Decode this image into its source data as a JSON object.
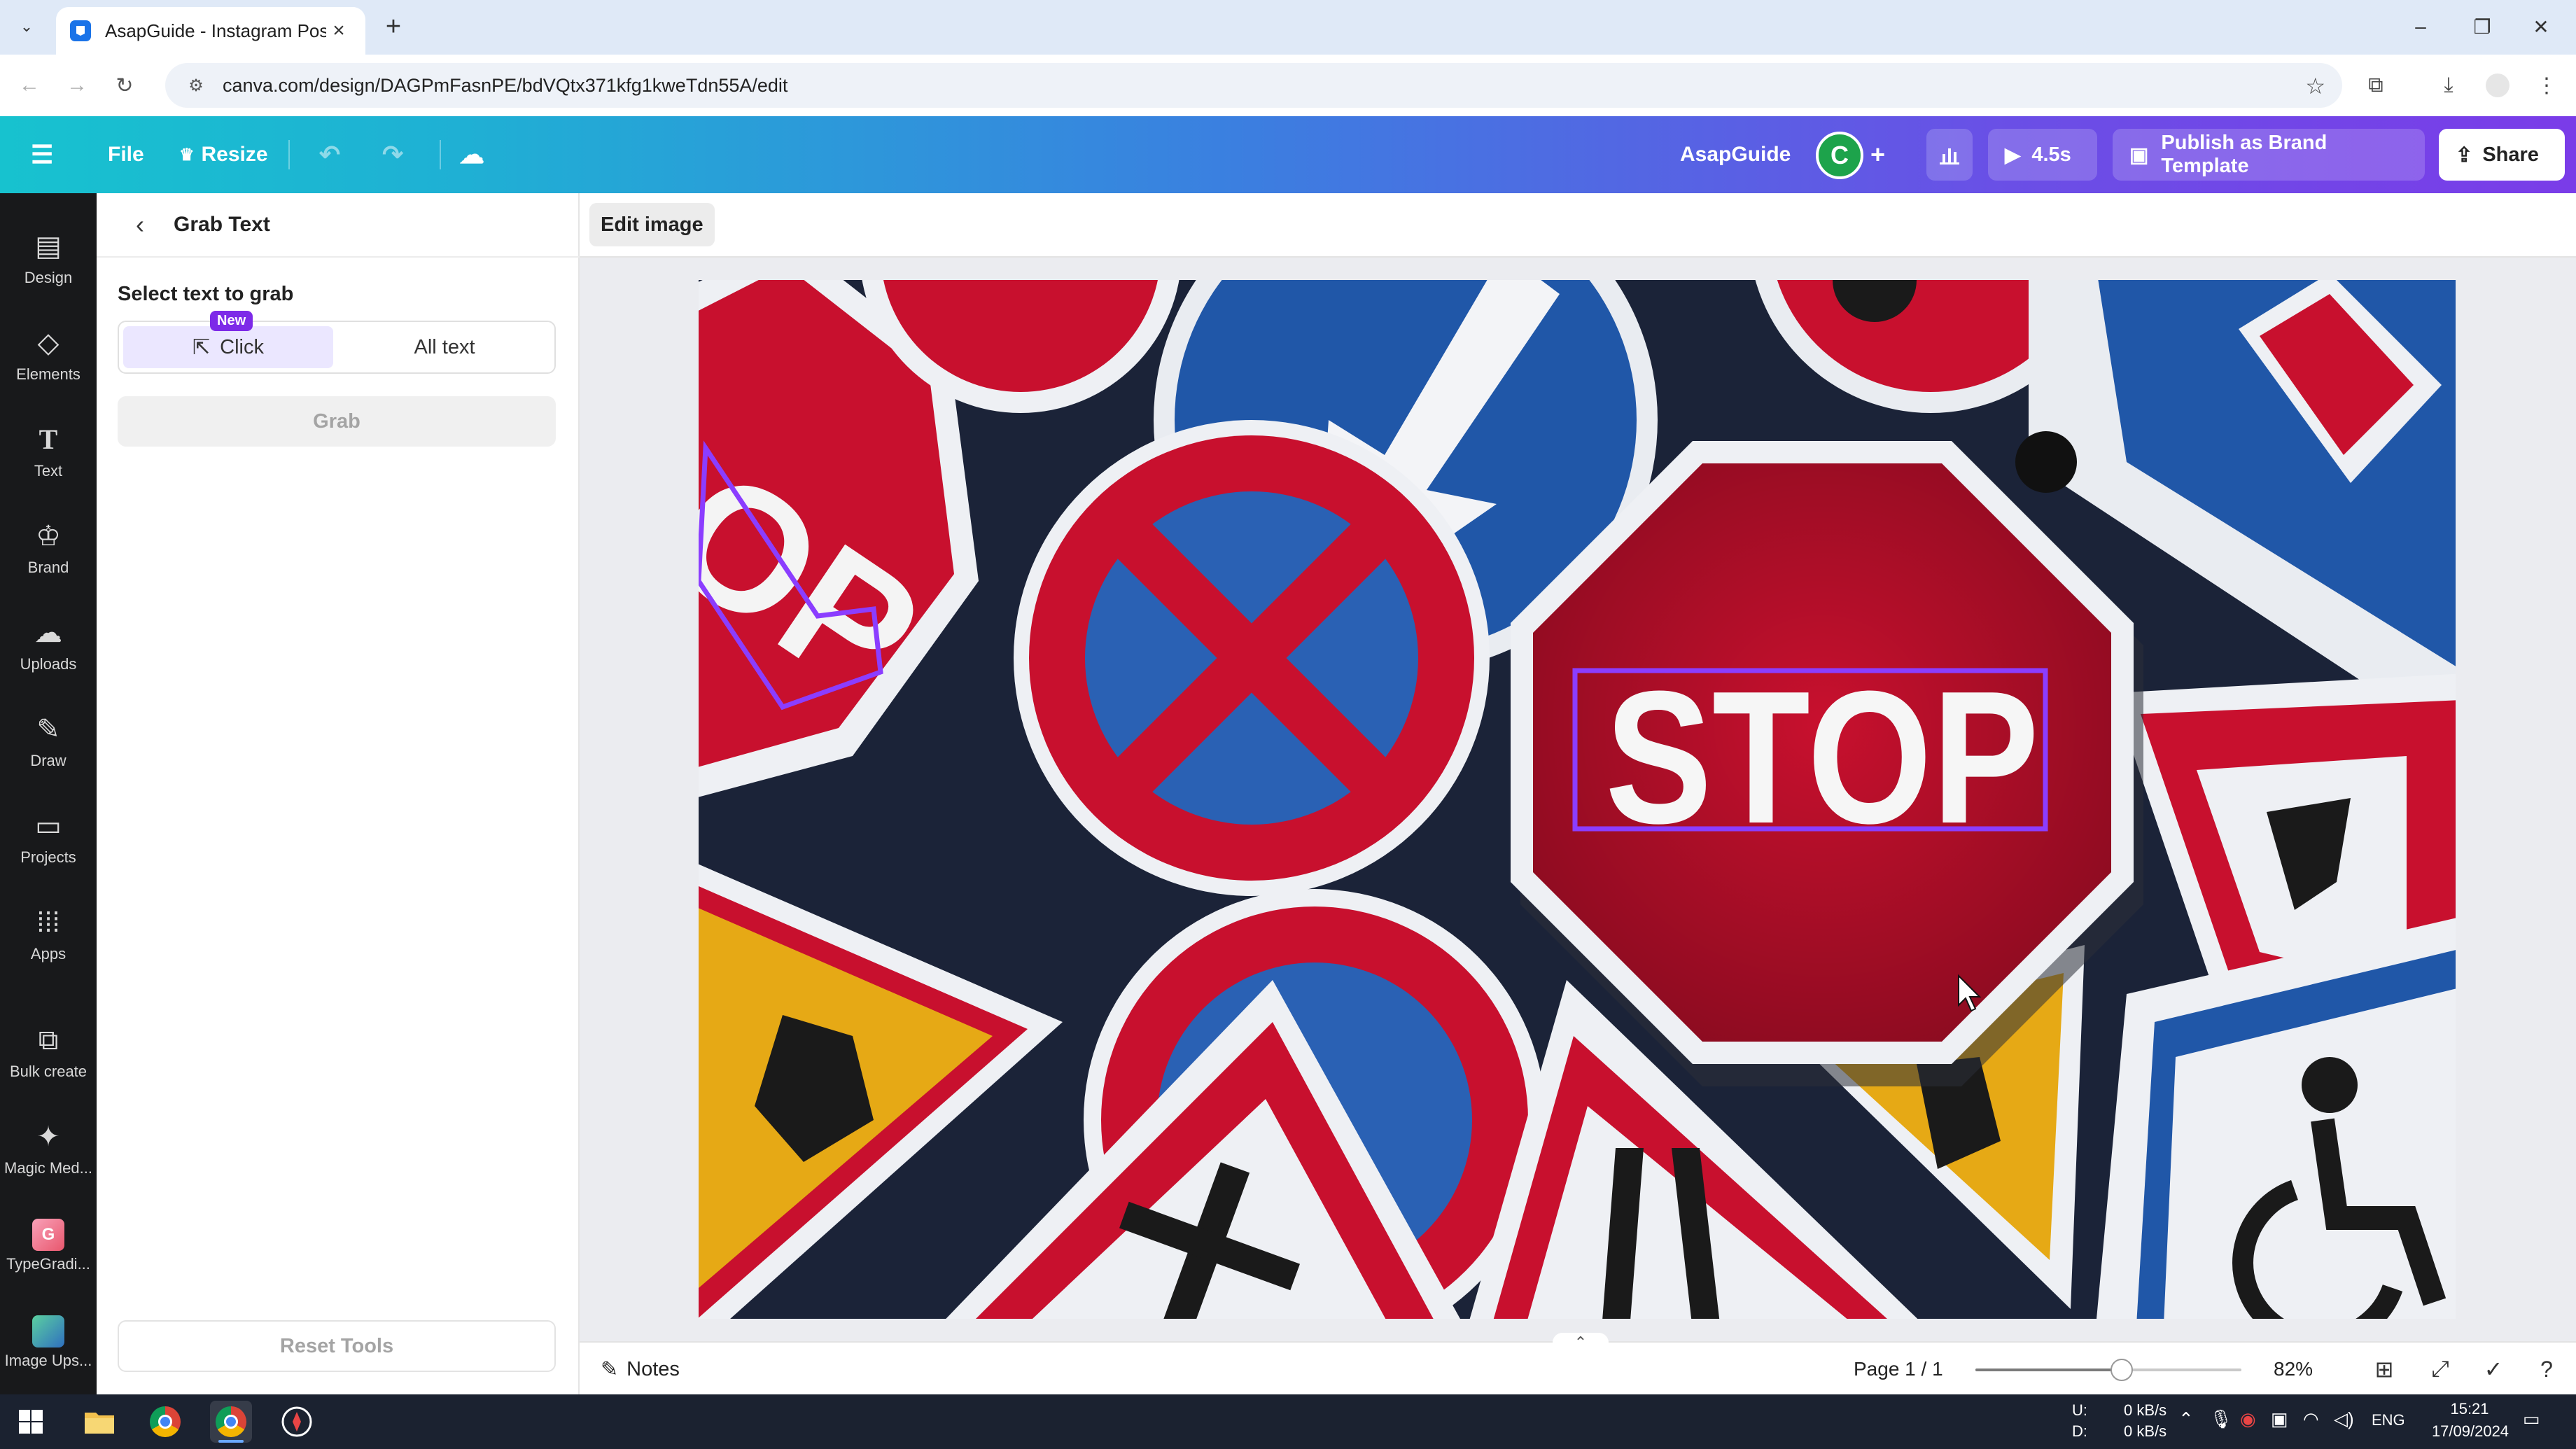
{
  "browser": {
    "tab_title": "AsapGuide - Instagram Post",
    "url": "canva.com/design/DAGPmFasnPE/bdVQtx371kfg1kweTdn55A/edit"
  },
  "topbar": {
    "file_label": "File",
    "resize_label": "Resize",
    "team_name": "AsapGuide",
    "avatar_initial": "C",
    "play_duration": "4.5s",
    "publish_label": "Publish as Brand Template",
    "share_label": "Share"
  },
  "rail": {
    "items": [
      {
        "label": "Design",
        "icon": "design-icon"
      },
      {
        "label": "Elements",
        "icon": "elements-icon"
      },
      {
        "label": "Text",
        "icon": "text-icon"
      },
      {
        "label": "Brand",
        "icon": "brand-icon"
      },
      {
        "label": "Uploads",
        "icon": "uploads-icon"
      },
      {
        "label": "Draw",
        "icon": "draw-icon"
      },
      {
        "label": "Projects",
        "icon": "projects-icon"
      },
      {
        "label": "Apps",
        "icon": "apps-icon"
      },
      {
        "label": "Bulk create",
        "icon": "bulk-create-icon"
      },
      {
        "label": "Magic Med...",
        "icon": "magic-media-icon"
      },
      {
        "label": "TypeGradi...",
        "icon": "typegradient-app-icon"
      },
      {
        "label": "Image Ups...",
        "icon": "image-upscaler-app-icon"
      }
    ]
  },
  "panel": {
    "title": "Grab Text",
    "section_label": "Select text to grab",
    "options": [
      "Click",
      "All text"
    ],
    "new_badge": "New",
    "grab_label": "Grab",
    "reset_label": "Reset Tools"
  },
  "workspace": {
    "edit_image_label": "Edit image",
    "canvas_text": {
      "stop_main": "STOP",
      "stop_partial": "OP"
    },
    "notes_label": "Notes",
    "page_indicator": "Page 1 / 1",
    "zoom": "82%",
    "zoom_fraction": 0.55
  },
  "taskbar": {
    "net_up_label": "U:",
    "net_down_label": "D:",
    "net_up": "0 kB/s",
    "net_down": "0 kB/s",
    "lang": "ENG",
    "time": "15:21",
    "date": "17/09/2024"
  },
  "colors": {
    "accent_purple": "#7d2ae8",
    "sign_red": "#c8102e",
    "sign_blue": "#1f56a8",
    "selection_outline": "#8b3dff"
  }
}
